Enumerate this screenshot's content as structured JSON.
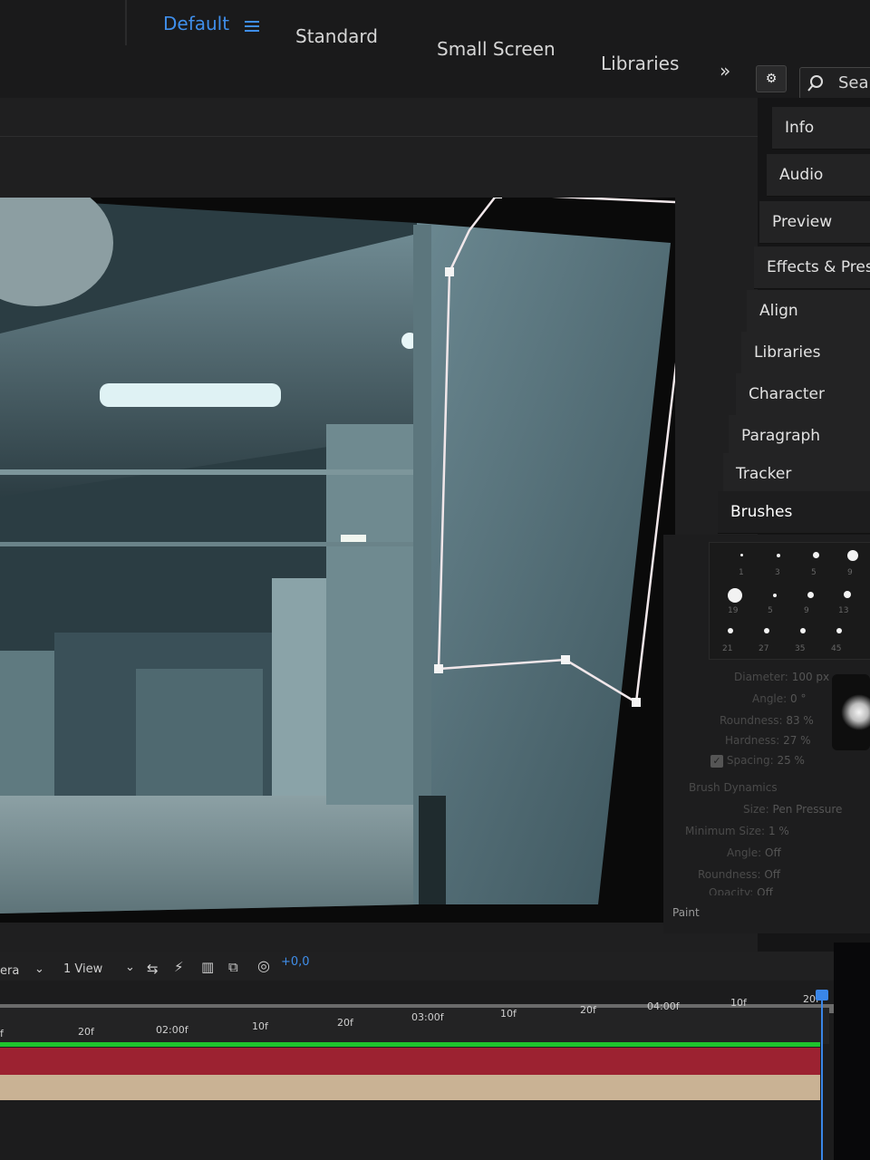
{
  "workspace_bar": {
    "items": [
      "Default",
      "Standard",
      "Small Screen",
      "Libraries"
    ],
    "active": "Default",
    "overflow_glyph": "»",
    "search_placeholder": "Sear"
  },
  "panels": {
    "tabs": [
      "Info",
      "Audio",
      "Preview",
      "Effects & Presets",
      "Align",
      "Libraries",
      "Character",
      "Paragraph",
      "Tracker",
      "Brushes"
    ],
    "brushes": {
      "tip_sizes": [
        "1",
        "3",
        "5",
        "9",
        "19",
        "5",
        "9",
        "13",
        "21",
        "27",
        "35",
        "45"
      ],
      "diameter_label": "Diameter:",
      "diameter_value": "100 px",
      "angle_label": "Angle:",
      "angle_value": "0 °",
      "roundness_label": "Roundness:",
      "roundness_value": "83 %",
      "hardness_label": "Hardness:",
      "hardness_value": "27 %",
      "spacing_label": "Spacing:",
      "spacing_value": "25 %",
      "dynamics_label": "Brush Dynamics",
      "size_label": "Size:",
      "size_value": "Pen Pressure",
      "min_size_label": "Minimum Size:",
      "min_size_value": "1 %",
      "dyn_angle_label": "Angle:",
      "dyn_angle_value": "Off",
      "dyn_roundness_label": "Roundness:",
      "dyn_roundness_value": "Off",
      "opacity_label": "Opacity:",
      "opacity_value": "Off"
    },
    "paint_label": "Paint"
  },
  "viewer_bar": {
    "camera": "era",
    "views": "1 View",
    "exposure": "+0,0"
  },
  "timeline": {
    "ruler_labels": [
      "f",
      "20f",
      "02:00f",
      "10f",
      "20f",
      "03:00f",
      "10f",
      "20f",
      "04:00f",
      "10f",
      "20f"
    ]
  },
  "colors": {
    "accent": "#3f8eea",
    "layer_green": "#1ec42d",
    "layer_red": "#9c2231",
    "layer_tan": "#c9b294"
  }
}
